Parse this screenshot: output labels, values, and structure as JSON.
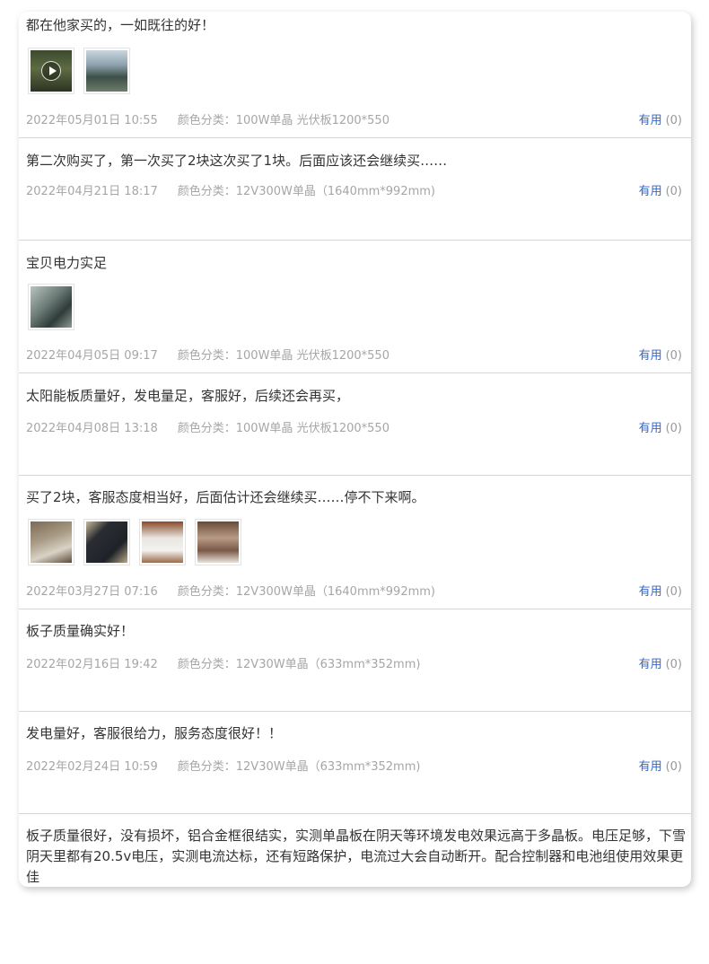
{
  "useful_label": "有用",
  "reviews": [
    {
      "content": "都在他家买的，一如既往的好！",
      "date": "2022年05月01日 10:55",
      "sku": "颜色分类：100W单晶 光伏板1200*550",
      "useful_count": "(0)",
      "images": [
        {
          "name": "video-thumb",
          "has_video": true
        },
        {
          "name": "photo-thumb"
        }
      ]
    },
    {
      "content": "第二次购买了，第一次买了2块这次买了1块。后面应该还会继续买……",
      "date": "2022年04月21日 18:17",
      "sku": "颜色分类：12V300W单晶（1640mm*992mm)",
      "useful_count": "(0)",
      "images": []
    },
    {
      "content": "宝贝电力实足",
      "date": "2022年04月05日 09:17",
      "sku": "颜色分类：100W单晶 光伏板1200*550",
      "useful_count": "(0)",
      "images": [
        {
          "name": "photo-thumb"
        }
      ]
    },
    {
      "content": "太阳能板质量好，发电量足，客服好，后续还会再买，",
      "date": "2022年04月08日 13:18",
      "sku": "颜色分类：100W单晶 光伏板1200*550",
      "useful_count": "(0)",
      "images": []
    },
    {
      "content": "买了2块，客服态度相当好，后面估计还会继续买……停不下来啊。",
      "date": "2022年03月27日 07:16",
      "sku": "颜色分类：12V300W单晶（1640mm*992mm)",
      "useful_count": "(0)",
      "images": [
        {
          "name": "photo-thumb"
        },
        {
          "name": "photo-thumb"
        },
        {
          "name": "photo-thumb"
        },
        {
          "name": "photo-thumb"
        }
      ]
    },
    {
      "content": "板子质量确实好！",
      "date": "2022年02月16日 19:42",
      "sku": "颜色分类：12V30W单晶（633mm*352mm)",
      "useful_count": "(0)",
      "images": []
    },
    {
      "content": "发电量好，客服很给力，服务态度很好！！",
      "date": "2022年02月24日 10:59",
      "sku": "颜色分类：12V30W单晶（633mm*352mm)",
      "useful_count": "(0)",
      "images": []
    },
    {
      "content": "板子质量很好，没有损坏，铝合金框很结实，实测单晶板在阴天等环境发电效果远高于多晶板。电压足够，下雪阴天里都有20.5v电压，实测电流达标，还有短路保护，电流过大会自动断开。配合控制器和电池组使用效果更佳"
    }
  ]
}
